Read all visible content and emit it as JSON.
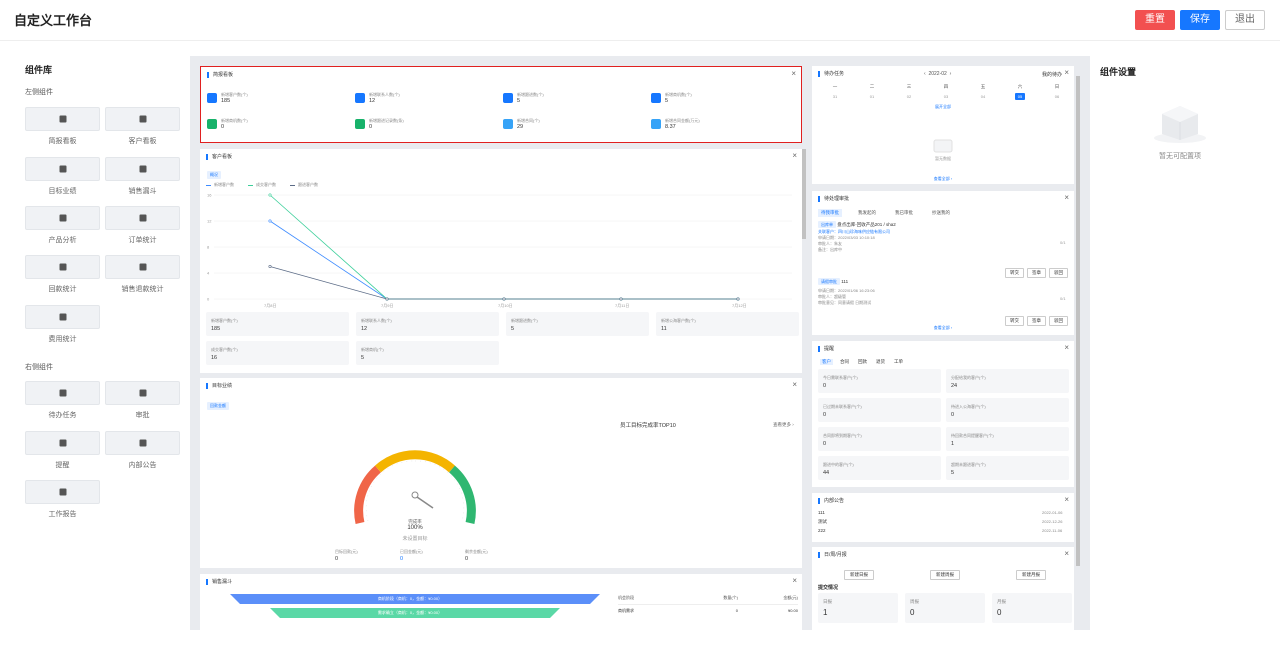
{
  "header": {
    "title": "自定义工作台",
    "reset": "重置",
    "save": "保存",
    "exit": "退出"
  },
  "library": {
    "title": "组件库",
    "left_group": "左侧组件",
    "left_items": [
      "简报看板",
      "客户看板",
      "目标业绩",
      "销售漏斗",
      "产品分析",
      "订单统计",
      "回款统计",
      "销售退款统计",
      "费用统计"
    ],
    "right_group": "右侧组件",
    "right_items": [
      "待办任务",
      "审批",
      "提醒",
      "内部公告",
      "工作报告"
    ]
  },
  "brief": {
    "title": "简报看板",
    "close": "×",
    "items": [
      {
        "label": "新增客户数(个)",
        "value": "185",
        "color": "#1677ff"
      },
      {
        "label": "新增联系人数(个)",
        "value": "12",
        "color": "#1677ff"
      },
      {
        "label": "新增跟进数(个)",
        "value": "5",
        "color": "#1677ff"
      },
      {
        "label": "新增商机数(个)",
        "value": "5",
        "color": "#1677ff"
      },
      {
        "label": "新增商机数(个)",
        "value": "0",
        "color": "#17b26a"
      },
      {
        "label": "新增跟进记录数(条)",
        "value": "0",
        "color": "#17b26a"
      },
      {
        "label": "新增合同(个)",
        "value": "29",
        "color": "#36a3f7"
      },
      {
        "label": "新增合同金额(万元)",
        "value": "8.37",
        "color": "#36a3f7"
      }
    ]
  },
  "customer": {
    "title": "客户看板",
    "tab": "概况",
    "legend": [
      "新增客户数",
      "成交客户数",
      "跟进客户数"
    ],
    "stats": [
      {
        "label": "新增客户数(个)",
        "value": "185"
      },
      {
        "label": "新增联系人数(个)",
        "value": "12"
      },
      {
        "label": "新增跟进数(个)",
        "value": "5"
      },
      {
        "label": "新增公海客户数(个)",
        "value": "11"
      },
      {
        "label": "成交客户数(个)",
        "value": "16"
      },
      {
        "label": "新增商机(个)",
        "value": "5"
      }
    ]
  },
  "chart_data": {
    "type": "line",
    "x": [
      "7月8日",
      "7月9日",
      "7月10日",
      "7月11日",
      "7月12日"
    ],
    "yticks": [
      "0",
      "4",
      "8",
      "12",
      "16"
    ],
    "ylim": [
      0,
      16
    ],
    "series": [
      {
        "name": "新增客户数",
        "color": "#3d8bff",
        "values": [
          12,
          0,
          0,
          0,
          0
        ]
      },
      {
        "name": "成交客户数",
        "color": "#3ccf9a",
        "values": [
          16,
          0,
          0,
          0,
          0
        ]
      },
      {
        "name": "跟进客户数",
        "color": "#5b6b86",
        "values": [
          5,
          0,
          0,
          0,
          0
        ]
      }
    ]
  },
  "goal": {
    "title": "目标业绩",
    "tab": "回款金额",
    "rank_title": "员工目标完成率TOP10",
    "more": "查看更多 ›",
    "gauge_label": "完成率",
    "gauge_value": "100%",
    "gauge_fraction": 1.0,
    "no_goal": "未设置目标",
    "metrics": [
      {
        "label": "目标回款(元)",
        "value": "0"
      },
      {
        "label": "已回金额(元)",
        "value": "0"
      },
      {
        "label": "剩余金额(元)",
        "value": "0"
      }
    ]
  },
  "funnel": {
    "title": "销售漏斗",
    "stage1": "商机阶段（商机：0，金额：¥0.00）",
    "stage2": "需求确立（商机：0，金额：¥0.00）",
    "table_headers": [
      "机会阶段",
      "数量(个)",
      "金额(元)"
    ],
    "table_rows": [
      {
        "stage": "商机需求",
        "count": "0",
        "amount": "¥0.00"
      }
    ]
  },
  "todo": {
    "title": "待办任务",
    "month": "2022-02",
    "my_label": "我的待办",
    "weekdays": [
      "一",
      "二",
      "三",
      "四",
      "五",
      "六",
      "日"
    ],
    "days": [
      "31",
      "01",
      "02",
      "03",
      "04",
      "05",
      "06"
    ],
    "expand": "展开全部",
    "empty": "暂无数据",
    "view_more": "查看全部 ›"
  },
  "approval": {
    "title": "待处理审批",
    "tabs": [
      "待我审批",
      "我发起的",
      "我已审批",
      "抄送我的"
    ],
    "item1_tag": "出库单",
    "item1_title": "盘点出库-回收产品201 / sha2",
    "item1_lines": [
      "关联客户：四川山珍海味供应链有限公司",
      "申请日期：2022/03/03 10:10:18",
      "审批人：朱友",
      "备注：出库中"
    ],
    "item1_page": "0/1",
    "item2_tag": "请假审批",
    "item2_title": "111",
    "item2_lines": [
      "申请日期：2022/01/06 16:23:06",
      "审批人：超级管",
      "审批意见：同意请假 日期测试"
    ],
    "item2_page": "0/1",
    "actions": [
      "转交",
      "签章",
      "驳回"
    ],
    "view_more": "查看全部 ›"
  },
  "remind": {
    "title": "提醒",
    "tabs": [
      "客户",
      "合同",
      "回款",
      "退货",
      "工单"
    ],
    "items": [
      {
        "label": "今日需联系客户(个)",
        "value": "0"
      },
      {
        "label": "分配给我的客户(个)",
        "value": "24"
      },
      {
        "label": "已过期未联系客户(个)",
        "value": "0"
      },
      {
        "label": "待进入公海客户(个)",
        "value": "0"
      },
      {
        "label": "合同即将到期客户(个)",
        "value": "0"
      },
      {
        "label": "待回款合同提醒客户(个)",
        "value": "1"
      },
      {
        "label": "跟进中的客户(个)",
        "value": "44"
      },
      {
        "label": "超期未跟进客户(个)",
        "value": "5"
      }
    ]
  },
  "notice": {
    "title": "内部公告",
    "items": [
      {
        "text": "111",
        "date": "2022-01-06"
      },
      {
        "text": "测试",
        "date": "2022-12-26"
      },
      {
        "text": "222",
        "date": "2022-11-06"
      }
    ]
  },
  "report": {
    "title": "日/周/月报",
    "buttons": [
      "新建日报",
      "新建周报",
      "新建月报"
    ],
    "subtitle": "提交情况",
    "items": [
      {
        "label": "日报",
        "value": "1"
      },
      {
        "label": "周报",
        "value": "0"
      },
      {
        "label": "月报",
        "value": "0"
      }
    ]
  },
  "settings": {
    "title": "组件设置",
    "empty": "暂无可配置项"
  }
}
